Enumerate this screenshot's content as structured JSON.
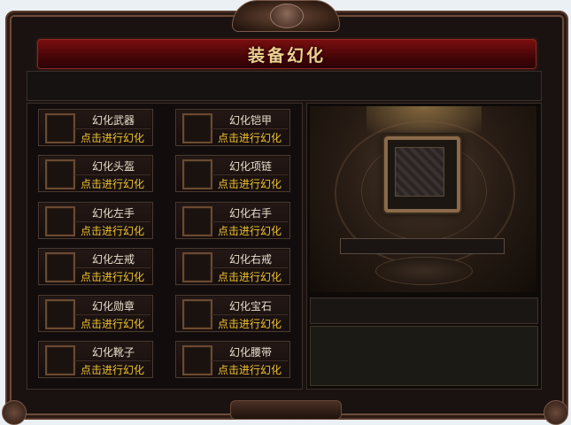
{
  "window": {
    "title": "装备幻化"
  },
  "slots": [
    {
      "name": "幻化武器",
      "action": "点击进行幻化"
    },
    {
      "name": "幻化铠甲",
      "action": "点击进行幻化"
    },
    {
      "name": "幻化头盔",
      "action": "点击进行幻化"
    },
    {
      "name": "幻化项链",
      "action": "点击进行幻化"
    },
    {
      "name": "幻化左手",
      "action": "点击进行幻化"
    },
    {
      "name": "幻化右手",
      "action": "点击进行幻化"
    },
    {
      "name": "幻化左戒",
      "action": "点击进行幻化"
    },
    {
      "name": "幻化右戒",
      "action": "点击进行幻化"
    },
    {
      "name": "幻化勋章",
      "action": "点击进行幻化"
    },
    {
      "name": "幻化宝石",
      "action": "点击进行幻化"
    },
    {
      "name": "幻化靴子",
      "action": "点击进行幻化"
    },
    {
      "name": "幻化腰带",
      "action": "点击进行幻化"
    }
  ],
  "colors": {
    "title": "#f0d090",
    "action_text": "#f0c230",
    "slot_text": "#eae0cc",
    "titlebar": "#7a0e10"
  }
}
